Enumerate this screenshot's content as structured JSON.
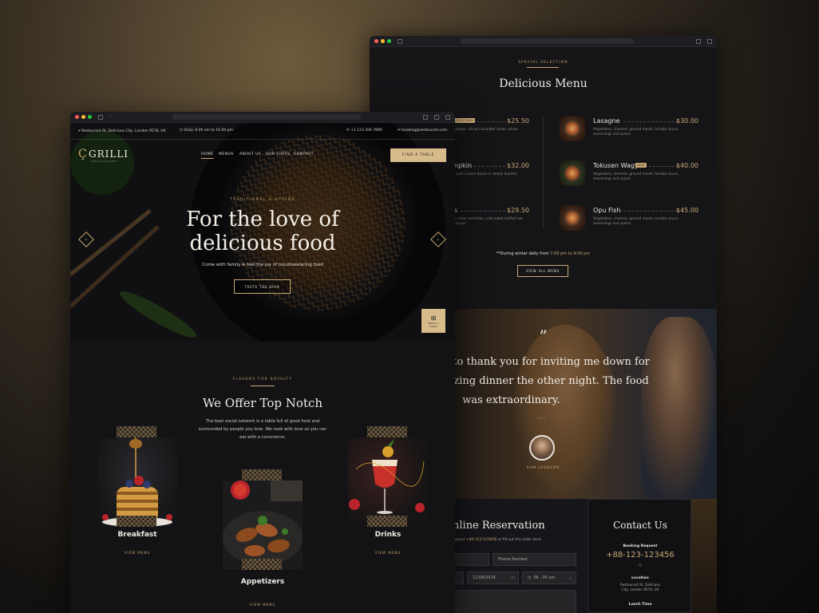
{
  "back": {
    "eyebrow": "SPECIAL SELECTION",
    "menu_title": "Delicious Menu",
    "left_items": [
      {
        "name": "",
        "price": "$25.50",
        "tag": "SEASONAL",
        "desc": "pepper, sliced cucumber onion, olives"
      },
      {
        "name": "npkin",
        "price": "$32.00",
        "tag": "",
        "desc": "mpkin Lorem Ipsum is simply dummy"
      },
      {
        "name": "s",
        "price": "$29.50",
        "tag": "",
        "desc": "s meat, red onion, crab salad stuffed red pepper"
      }
    ],
    "right_items": [
      {
        "name": "Lasagne",
        "price": "$30.00",
        "tag": "",
        "desc": "Vegetables, cheeses, ground meats, tomato sauce, seasonings and spices"
      },
      {
        "name": "Tokusen Wagyu",
        "price": "$40.00",
        "tag": "NEW",
        "desc": "Vegetables, cheeses, ground meats, tomato sauce, seasonings and spices"
      },
      {
        "name": "Opu Fish",
        "price": "$45.00",
        "tag": "",
        "desc": "Vegetables, cheeses, ground meats, tomato sauce, seasonings and spices"
      }
    ],
    "hours_prefix": "**During winter daily from",
    "hours_from": "7:00 pm",
    "hours_to": "to 9:00 pm",
    "view_all": "VIEW ALL MENU",
    "quote_mark": "”",
    "quote_line1": "ed to thank you for inviting me down for",
    "quote_line2": "mazing dinner the other night. The food",
    "quote_line3": "was extraordinary.",
    "reviewer": "SAM JHONSON",
    "reservation_title": "nline Reservation",
    "reservation_note_a": "equest",
    "reservation_phone": "+88-123-123456",
    "reservation_note_b": "or fill out the order form",
    "phone_placeholder": "Phone Number",
    "date_value": "11/08/2024",
    "time_value": "06 : 00 am",
    "contact_title": "Contact Us",
    "booking_label": "Booking Request",
    "booking_phone": "+88-123-123456",
    "location_label": "Location",
    "location_line1": "Restaurant St, Delicious",
    "location_line2": "City, London 9578, UK",
    "lunch_label": "Lunch Time"
  },
  "front": {
    "topbar_address": "Restaurant St, Delicious City, London 9578, UK",
    "topbar_hours": "Daily: 8.00 am to 10.00 pm",
    "topbar_phone": "+1 123 456 7890",
    "topbar_email": "booking@restaurant.com",
    "brand": "GRILLI",
    "brand_sub": "RESTAURANT",
    "nav": [
      "HOME",
      "MENUS",
      "ABOUT US",
      "OUR CHEFS",
      "CONTACT"
    ],
    "find_table": "FIND A TABLE",
    "hero_eyebrow": "TRADITIONAL & HYGINE",
    "hero_title_1": "For the love of",
    "hero_title_2": "delicious food",
    "hero_sub": "Come with family & feel the joy of mouthwatering food",
    "hero_cta": "TASTE THE DISH",
    "book_badge": "BOOK A TABLE",
    "section_eyebrow": "FLAVORS FOR ROYALTY",
    "section_title": "We Offer Top Notch",
    "section_text_1": "The best social network is a table full of good food and",
    "section_text_2": "surrounded by people you love. We cook with love so you can",
    "section_text_3": "eat with a conscience.",
    "categories": [
      {
        "title": "Breakfast",
        "link": "VIEW MENU"
      },
      {
        "title": "Appetizers",
        "link": "VIEW MENU"
      },
      {
        "title": "Drinks",
        "link": "VIEW MENU"
      }
    ]
  },
  "colors": {
    "accent": "#c9a873",
    "bg": "#141416"
  }
}
